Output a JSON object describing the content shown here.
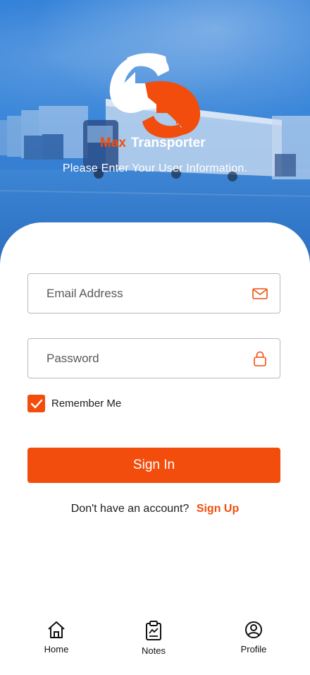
{
  "brand": {
    "name_part1": "Max",
    "name_part2": "Transporter",
    "colors": {
      "primary": "#f24d0c",
      "hero_blue": "#2f7fd8"
    }
  },
  "hero": {
    "tagline": "Please Enter Your User Information."
  },
  "form": {
    "email_placeholder": "Email Address",
    "email_icon": "mail-icon",
    "password_placeholder": "Password",
    "password_icon": "lock-icon",
    "remember_label": "Remember Me",
    "remember_checked": true,
    "signin_label": "Sign In",
    "signup_prompt": "Don't have an account?",
    "signup_link": "Sign Up"
  },
  "nav": {
    "items": [
      {
        "label": "Home",
        "icon": "home-icon"
      },
      {
        "label": "Notes",
        "icon": "clipboard-icon"
      },
      {
        "label": "Profile",
        "icon": "user-circle-icon"
      }
    ]
  }
}
